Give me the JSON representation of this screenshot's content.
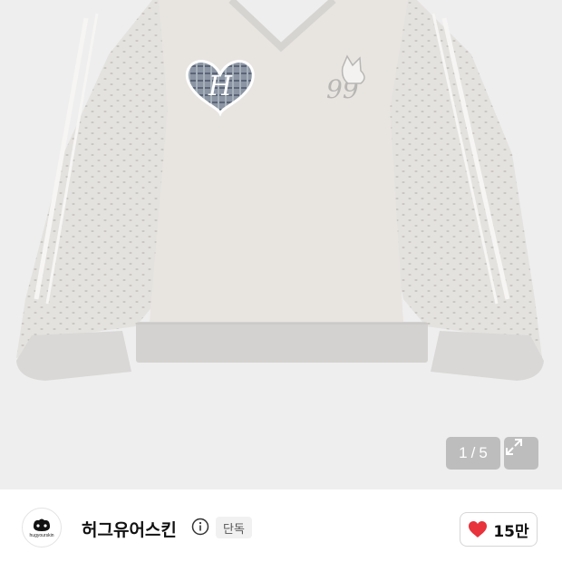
{
  "gallery": {
    "current": "1",
    "separator": "/",
    "total": "5",
    "expand_icon": "expand-arrows-icon"
  },
  "brand": {
    "logo_text": "hugyourskin",
    "name": "허그유어스킨",
    "info_icon": "info-icon",
    "badge": "단독"
  },
  "like": {
    "icon": "heart-icon",
    "color": "#e8323c",
    "count": "15만"
  }
}
